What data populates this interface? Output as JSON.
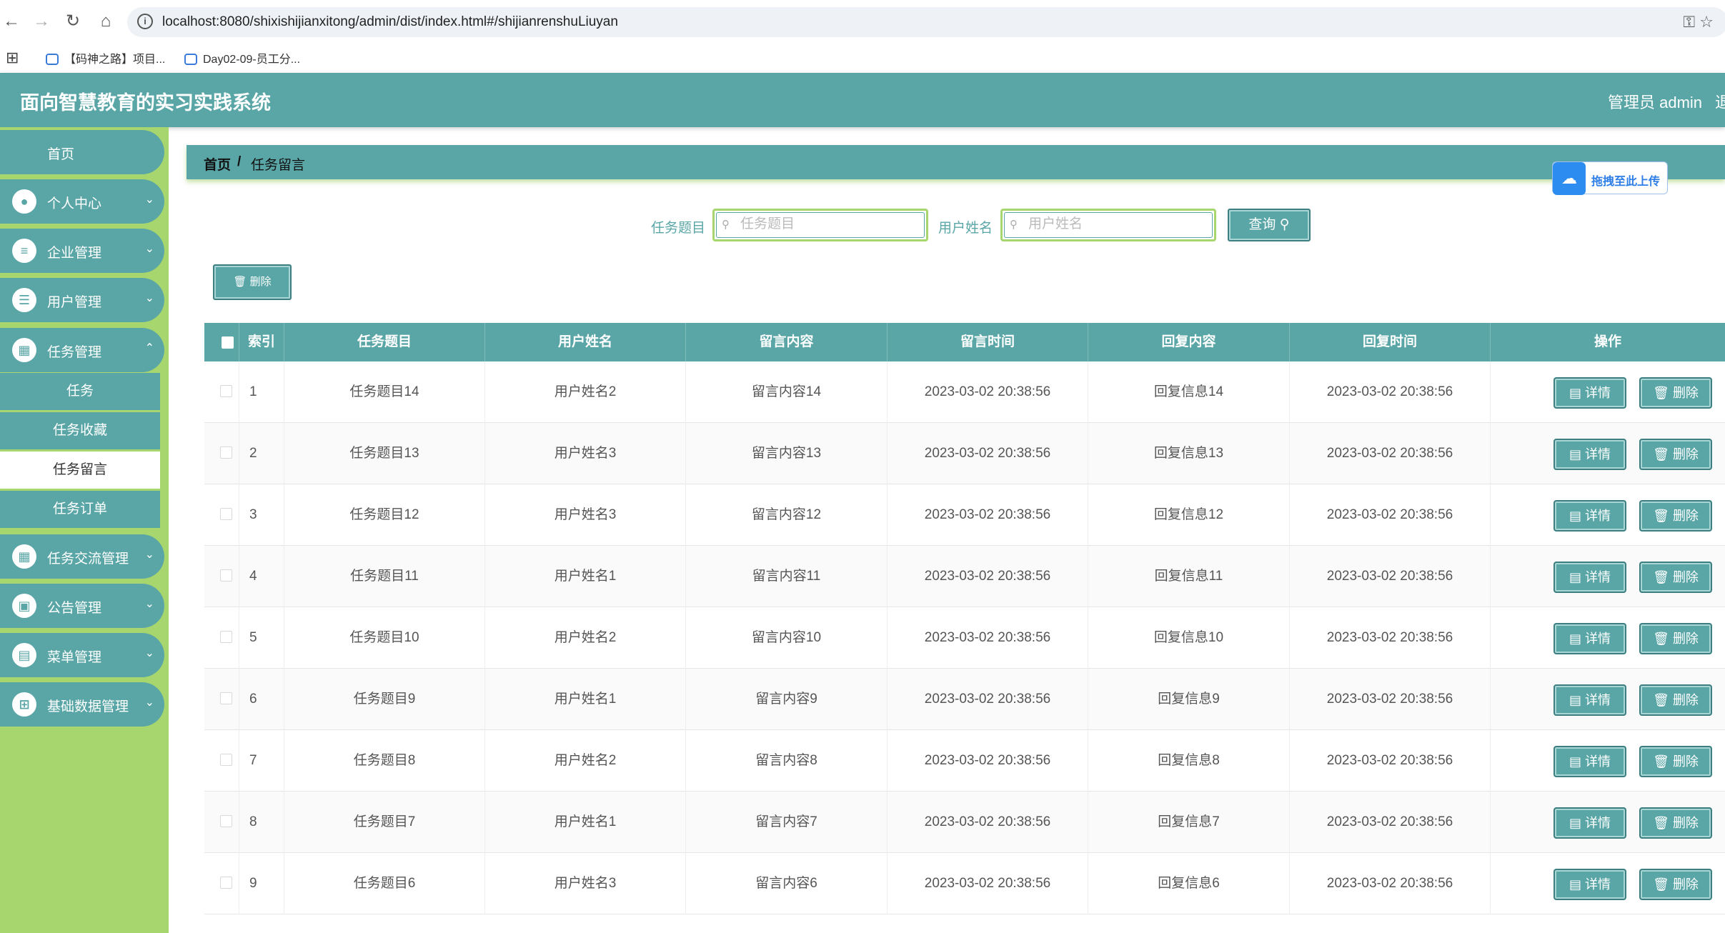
{
  "browser": {
    "url": "localhost:8080/shixishijianxitong/admin/dist/index.html#/shijianrenshuLiuyan",
    "bookmarks": [
      "【码神之路】项目...",
      "Day02-09-员工分..."
    ]
  },
  "app": {
    "title": "面向智慧教育的实习实践系统",
    "user": "管理员 admin",
    "user_extra": "退"
  },
  "sidebar": {
    "home": "首页",
    "items": [
      {
        "label": "个人中心",
        "icon": "person-icon"
      },
      {
        "label": "企业管理",
        "icon": "sliders-icon"
      },
      {
        "label": "用户管理",
        "icon": "list-icon"
      },
      {
        "label": "任务管理",
        "icon": "grid-icon"
      }
    ],
    "sub_items": [
      "任务",
      "任务收藏",
      "任务留言",
      "任务订单"
    ],
    "items_after": [
      {
        "label": "任务交流管理",
        "icon": "grid-icon"
      },
      {
        "label": "公告管理",
        "icon": "chart-icon"
      },
      {
        "label": "菜单管理",
        "icon": "clipboard-icon"
      },
      {
        "label": "基础数据管理",
        "icon": "apps-icon"
      }
    ]
  },
  "breadcrumb": {
    "home": "首页",
    "separator": "/",
    "current": "任务留言"
  },
  "upload_badge": "拖拽至此上传",
  "search": {
    "title_label": "任务题目",
    "title_placeholder": "任务题目",
    "title_value": "",
    "user_label": "用户姓名",
    "user_placeholder": "用户姓名",
    "user_value": "",
    "query_button": "查询"
  },
  "bulk_delete_button": "删除",
  "table": {
    "columns": [
      "索引",
      "任务题目",
      "用户姓名",
      "留言内容",
      "留言时间",
      "回复内容",
      "回复时间",
      "操作"
    ],
    "detail_button": "详情",
    "delete_button": "删除",
    "rows": [
      [
        "1",
        "任务题目14",
        "用户姓名2",
        "留言内容14",
        "2023-03-02 20:38:56",
        "回复信息14",
        "2023-03-02 20:38:56"
      ],
      [
        "2",
        "任务题目13",
        "用户姓名3",
        "留言内容13",
        "2023-03-02 20:38:56",
        "回复信息13",
        "2023-03-02 20:38:56"
      ],
      [
        "3",
        "任务题目12",
        "用户姓名3",
        "留言内容12",
        "2023-03-02 20:38:56",
        "回复信息12",
        "2023-03-02 20:38:56"
      ],
      [
        "4",
        "任务题目11",
        "用户姓名1",
        "留言内容11",
        "2023-03-02 20:38:56",
        "回复信息11",
        "2023-03-02 20:38:56"
      ],
      [
        "5",
        "任务题目10",
        "用户姓名2",
        "留言内容10",
        "2023-03-02 20:38:56",
        "回复信息10",
        "2023-03-02 20:38:56"
      ],
      [
        "6",
        "任务题目9",
        "用户姓名1",
        "留言内容9",
        "2023-03-02 20:38:56",
        "回复信息9",
        "2023-03-02 20:38:56"
      ],
      [
        "7",
        "任务题目8",
        "用户姓名2",
        "留言内容8",
        "2023-03-02 20:38:56",
        "回复信息8",
        "2023-03-02 20:38:56"
      ],
      [
        "8",
        "任务题目7",
        "用户姓名1",
        "留言内容7",
        "2023-03-02 20:38:56",
        "回复信息7",
        "2023-03-02 20:38:56"
      ],
      [
        "9",
        "任务题目6",
        "用户姓名3",
        "留言内容6",
        "2023-03-02 20:38:56",
        "回复信息6",
        "2023-03-02 20:38:56"
      ]
    ]
  },
  "colors": {
    "primary": "#5aa6a7",
    "sidebar_bg": "#a8d66e",
    "upload_blue": "#2d8cf0"
  }
}
